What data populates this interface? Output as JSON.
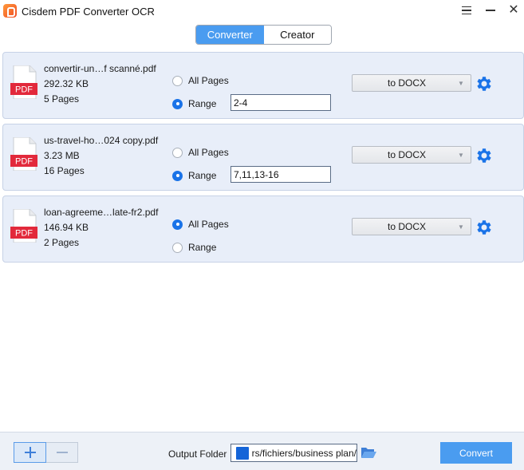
{
  "window": {
    "title": "Cisdem PDF Converter OCR"
  },
  "tabs": [
    {
      "label": "Converter",
      "active": true
    },
    {
      "label": "Creator",
      "active": false
    }
  ],
  "files": [
    {
      "name": "convertir-un…f scanné.pdf",
      "size": "292.32 KB",
      "pages": "5 Pages",
      "icon_label": "PDF",
      "all_pages_label": "All Pages",
      "range_label": "Range",
      "selected": "range",
      "range_value": "2-4",
      "format": "to DOCX"
    },
    {
      "name": "us-travel-ho…024 copy.pdf",
      "size": "3.23 MB",
      "pages": "16 Pages",
      "icon_label": "PDF",
      "all_pages_label": "All Pages",
      "range_label": "Range",
      "selected": "range",
      "range_value": "7,11,13-16",
      "format": "to DOCX"
    },
    {
      "name": "loan-agreeme…late-fr2.pdf",
      "size": "146.94 KB",
      "pages": "2 Pages",
      "icon_label": "PDF",
      "all_pages_label": "All Pages",
      "range_label": "Range",
      "selected": "all",
      "range_value": "",
      "format": "to DOCX"
    }
  ],
  "footer": {
    "output_label": "Output Folder",
    "output_path": "/Users/fichiers/business plan",
    "convert_label": "Convert"
  },
  "colors": {
    "accent": "#4a9cf0",
    "radio_checked": "#1a73e8",
    "pdf_red": "#e2293b",
    "gear_blue": "#1a73e8",
    "card_bg": "#e8eef9"
  },
  "icons": {
    "app": "cisdem-logo-icon",
    "file": "pdf-file-icon",
    "settings": "gear-icon",
    "folder": "folder-icon",
    "browse": "open-folder-icon"
  }
}
